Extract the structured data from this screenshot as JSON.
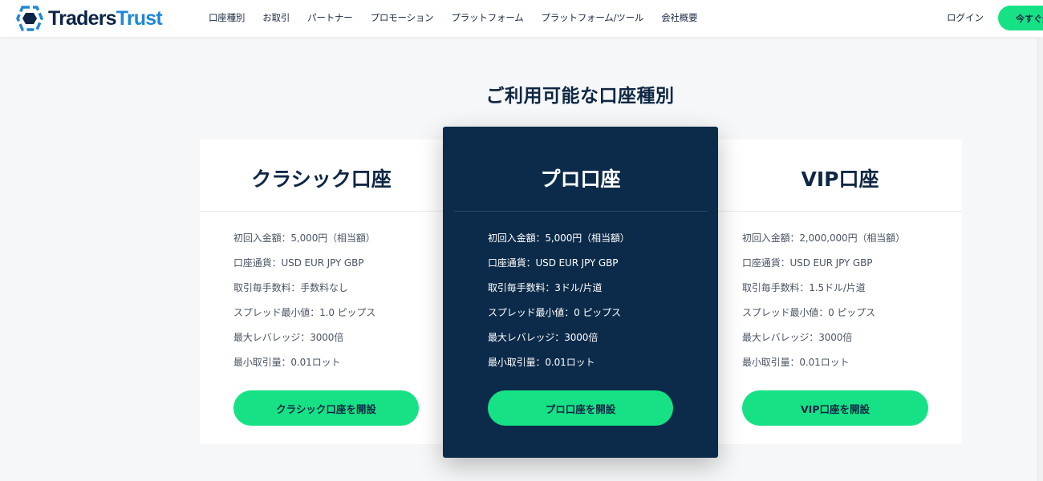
{
  "header": {
    "logo_part1": "Traders",
    "logo_part2": "Trust",
    "nav": [
      "口座種別",
      "お取引",
      "パートナー",
      "プロモーション",
      "プラットフォーム",
      "プラットフォーム/ツール",
      "会社概要"
    ],
    "login_label": "ログイン",
    "cta_label": "今すぐ登",
    "accent_color": "#16e285",
    "brand_color": "#1e88d6"
  },
  "section": {
    "title": "ご利用可能な口座種別"
  },
  "accounts": [
    {
      "name": "クラシック口座",
      "features": [
        "初回入金額：5,000円（相当額）",
        "口座通貨：USD EUR JPY GBP",
        "取引毎手数料：手数料なし",
        "スプレッド最小値：1.0 ピップス",
        "最大レバレッジ：3000倍",
        "最小取引量：0.01ロット"
      ],
      "button": "クラシック口座を開設"
    },
    {
      "name": "プロ口座",
      "features": [
        "初回入金額：5,000円（相当額）",
        "口座通貨：USD EUR JPY GBP",
        "取引毎手数料：3ドル/片道",
        "スプレッド最小値：0 ピップス",
        "最大レバレッジ：3000倍",
        "最小取引量：0.01ロット"
      ],
      "button": "プロ口座を開設",
      "highlight_color": "#0c2b4a"
    },
    {
      "name": "VIP口座",
      "features": [
        "初回入金額：2,000,000円（相当額）",
        "口座通貨：USD EUR JPY GBP",
        "取引毎手数料：1.5ドル/片道",
        "スプレッド最小値：0 ピップス",
        "最大レバレッジ：3000倍",
        "最小取引量：0.01ロット"
      ],
      "button": "VIP口座を開設"
    }
  ]
}
